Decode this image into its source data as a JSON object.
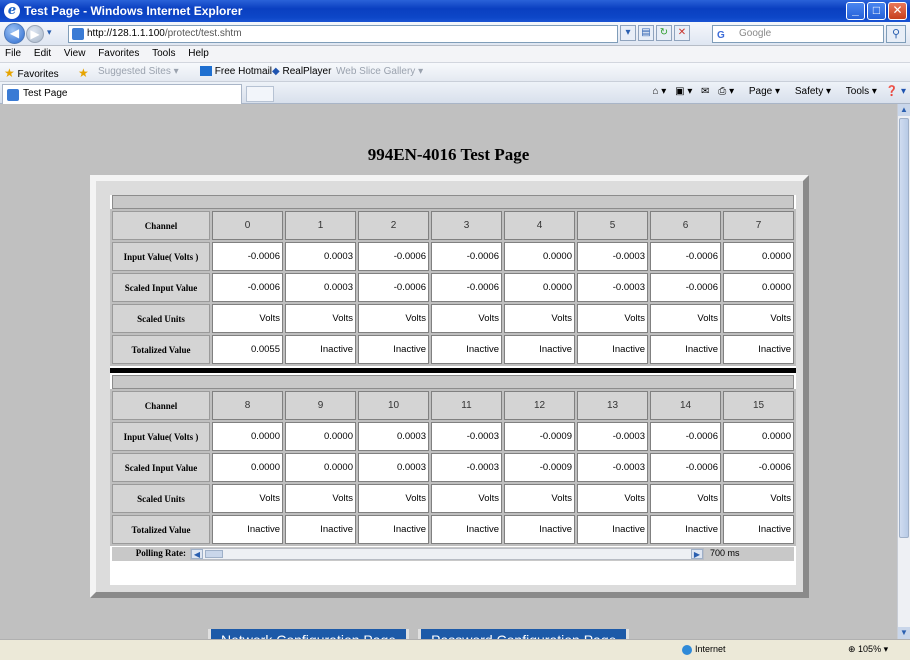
{
  "window": {
    "title": "Test Page - Windows Internet Explorer"
  },
  "address": {
    "url_host": "http://128.1.1.100",
    "url_path": "/protect/test.shtm",
    "search_placeholder": "Google"
  },
  "menu": [
    "File",
    "Edit",
    "View",
    "Favorites",
    "Tools",
    "Help"
  ],
  "favorites": {
    "label": "Favorites",
    "items": [
      "Suggested Sites",
      "Free Hotmail",
      "RealPlayer",
      "Web Slice Gallery"
    ]
  },
  "tab": {
    "title": "Test Page"
  },
  "commands": [
    "Page",
    "Safety",
    "Tools"
  ],
  "page": {
    "title": "994EN-4016 Test Page",
    "row_labels": [
      "Channel",
      "Input Value( Volts )",
      "Scaled Input Value",
      "Scaled Units",
      "Totalized Value"
    ],
    "group1": {
      "channels": [
        "0",
        "1",
        "2",
        "3",
        "4",
        "5",
        "6",
        "7"
      ],
      "input": [
        "-0.0006",
        "0.0003",
        "-0.0006",
        "-0.0006",
        "0.0000",
        "-0.0003",
        "-0.0006",
        "0.0000"
      ],
      "scaled": [
        "-0.0006",
        "0.0003",
        "-0.0006",
        "-0.0006",
        "0.0000",
        "-0.0003",
        "-0.0006",
        "0.0000"
      ],
      "units": [
        "Volts",
        "Volts",
        "Volts",
        "Volts",
        "Volts",
        "Volts",
        "Volts",
        "Volts"
      ],
      "totalized": [
        "0.0055",
        "Inactive",
        "Inactive",
        "Inactive",
        "Inactive",
        "Inactive",
        "Inactive",
        "Inactive"
      ]
    },
    "group2": {
      "channels": [
        "8",
        "9",
        "10",
        "11",
        "12",
        "13",
        "14",
        "15"
      ],
      "input": [
        "0.0000",
        "0.0000",
        "0.0003",
        "-0.0003",
        "-0.0009",
        "-0.0003",
        "-0.0006",
        "0.0000"
      ],
      "scaled": [
        "0.0000",
        "0.0000",
        "0.0003",
        "-0.0003",
        "-0.0009",
        "-0.0003",
        "-0.0006",
        "-0.0006"
      ],
      "units": [
        "Volts",
        "Volts",
        "Volts",
        "Volts",
        "Volts",
        "Volts",
        "Volts",
        "Volts"
      ],
      "totalized": [
        "Inactive",
        "Inactive",
        "Inactive",
        "Inactive",
        "Inactive",
        "Inactive",
        "Inactive",
        "Inactive"
      ]
    },
    "polling": {
      "label": "Polling Rate:",
      "value": "700 ms"
    },
    "buttons": {
      "network": "Network Configuration Page",
      "password": "Password Configuration Page"
    }
  },
  "status": {
    "zone": "Internet",
    "zoom": "105%"
  }
}
